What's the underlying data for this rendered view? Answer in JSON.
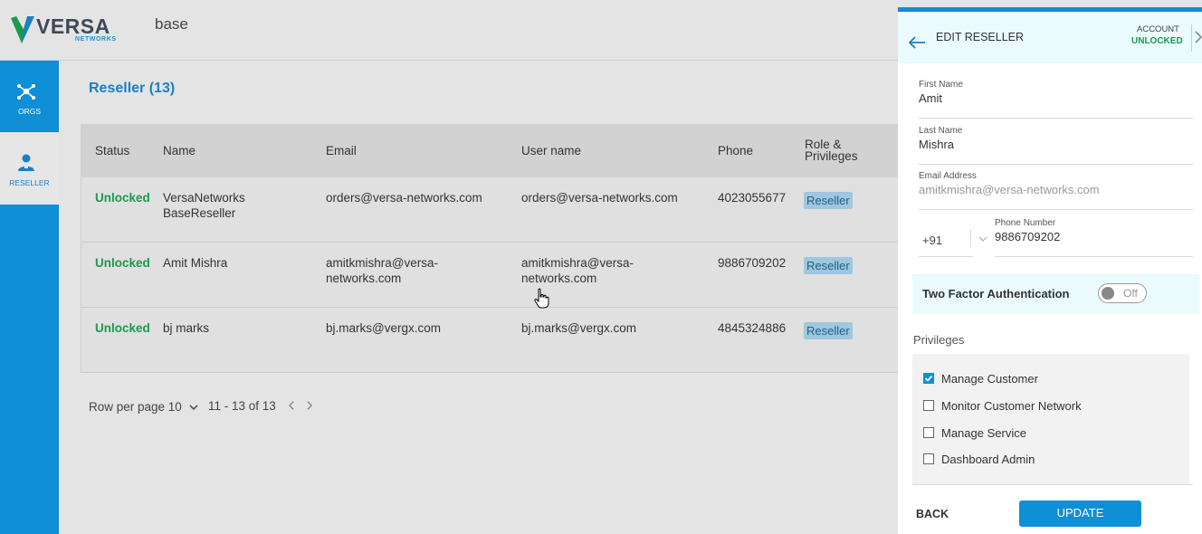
{
  "header": {
    "brand": "VERSA",
    "brand_sub": "NETWORKS",
    "title": "base"
  },
  "sidebar": {
    "items": [
      {
        "label": "ORGS",
        "icon": "network-icon"
      },
      {
        "label": "RESELLER",
        "icon": "user-icon",
        "active": true
      }
    ]
  },
  "main": {
    "title": "Reseller (13)",
    "columns": [
      "Status",
      "Name",
      "Email",
      "User name",
      "Phone",
      "Role &",
      "Privileges"
    ],
    "rows": [
      {
        "status": "Unlocked",
        "name1": "VersaNetworks",
        "name2": "BaseReseller",
        "email1": "orders@versa-networks.com",
        "email2": "",
        "user1": "orders@versa-networks.com",
        "user2": "",
        "phone": "4023055677",
        "role": "Reseller"
      },
      {
        "status": "Unlocked",
        "name1": "Amit Mishra",
        "name2": "",
        "email1": "amitkmishra@versa-",
        "email2": "networks.com",
        "user1": "amitkmishra@versa-",
        "user2": "networks.com",
        "phone": "9886709202",
        "role": "Reseller"
      },
      {
        "status": "Unlocked",
        "name1": "bj marks",
        "name2": "",
        "email1": "bj.marks@vergx.com",
        "email2": "",
        "user1": "bj.marks@vergx.com",
        "user2": "",
        "phone": "4845324886",
        "role": "Reseller"
      }
    ],
    "pager": {
      "rows_label": "Row per page 10",
      "range": "11 - 13 of 13"
    }
  },
  "panel": {
    "title": "EDIT RESELLER",
    "account_label": "ACCOUNT",
    "account_status": "UNLOCKED",
    "first_name_label": "First Name",
    "first_name": "Amit",
    "last_name_label": "Last Name",
    "last_name": "Mishra",
    "email_label": "Email Address",
    "email": "amitkmishra@versa-networks.com",
    "country_code": "+91",
    "phone_label": "Phone Number",
    "phone": "9886709202",
    "tfa_label": "Two Factor Authentication",
    "tfa_state": "Off",
    "privileges_title": "Privileges",
    "privileges": [
      {
        "label": "Manage Customer",
        "checked": true
      },
      {
        "label": "Monitor Customer Network",
        "checked": false
      },
      {
        "label": "Manage Service",
        "checked": false
      },
      {
        "label": "Dashboard Admin",
        "checked": false
      }
    ],
    "back_label": "BACK",
    "update_label": "UPDATE"
  },
  "colors": {
    "accent": "#0e8fd6",
    "status_green": "#1a9a4b",
    "panel_head_bg": "#eafafd"
  }
}
